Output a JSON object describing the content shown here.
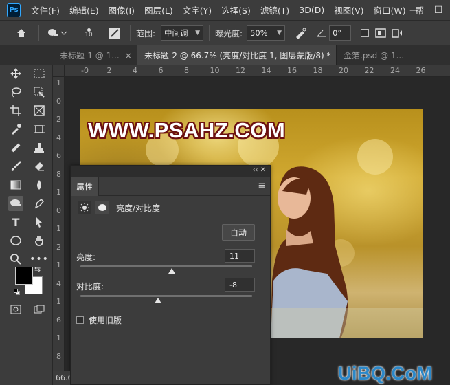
{
  "app": {
    "logo_text": "Ps"
  },
  "menu": [
    "文件(F)",
    "编辑(E)",
    "图像(I)",
    "图层(L)",
    "文字(Y)",
    "选择(S)",
    "滤镜(T)",
    "3D(D)",
    "视图(V)",
    "窗口(W)",
    "帮"
  ],
  "window_controls": {
    "minimize": "—",
    "maximize": "☐"
  },
  "options": {
    "brush_size": "10",
    "range_label": "范围:",
    "range_value": "中间调",
    "exposure_label": "曝光度:",
    "exposure_value": "50%",
    "angle_value": "0°"
  },
  "tabs": [
    {
      "label": "未标题-1 @ 1...",
      "close": "×"
    },
    {
      "label": "未标题-2 @ 66.7% (亮度/对比度 1, 图层蒙版/8) *",
      "close": "×"
    },
    {
      "label": "金箔.psd @ 1...",
      "close": ""
    }
  ],
  "toolbox": {
    "collapse": "‹‹"
  },
  "ruler": {
    "h": [
      "-0",
      "2",
      "4",
      "6",
      "8",
      "10",
      "12",
      "14",
      "16",
      "18",
      "20",
      "22",
      "24",
      "26"
    ],
    "v": [
      "1",
      "0",
      "2",
      "4",
      "6",
      "8",
      "1",
      "0",
      "1",
      "2",
      "1",
      "4",
      "1",
      "6",
      "1",
      "8"
    ]
  },
  "canvas": {
    "watermark": "WWW.PSAHZ.COM"
  },
  "properties": {
    "top_controls": "‹‹ ✕",
    "tab_label": "属性",
    "menu_icon": "≡",
    "adjustment_name": "亮度/对比度",
    "auto_button": "自动",
    "brightness_label": "亮度:",
    "brightness_value": "11",
    "brightness_level": 0.53,
    "contrast_label": "对比度:",
    "contrast_value": "-8",
    "contrast_level": 0.45,
    "legacy_label": "使用旧版"
  },
  "status": {
    "zoom": "66.6"
  },
  "brand": {
    "text": "UiBQ.CoM"
  }
}
